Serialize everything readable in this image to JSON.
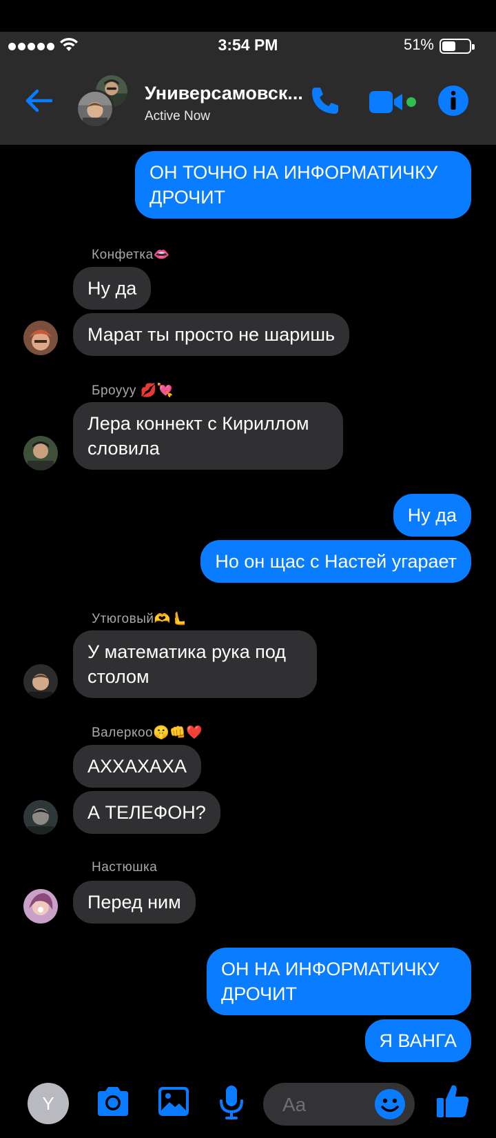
{
  "status_bar": {
    "time": "3:54 PM",
    "battery": "51%",
    "battery_level": 0.51
  },
  "header": {
    "title": "Универсамовск...",
    "subtitle": "Active Now",
    "icons": [
      "back-arrow-icon",
      "phone-icon",
      "video-icon",
      "info-icon"
    ]
  },
  "messages": [
    {
      "from": "me",
      "text": "ОН ТОЧНО НА ИНФОРМАТИЧКУ ДРОЧИТ"
    },
    {
      "from": "Конфетка👄",
      "sender_label": "Конфетка👄",
      "text": "Ну да"
    },
    {
      "from": "Конфетка👄",
      "text": "Марат ты просто не шаришь"
    },
    {
      "from": "Броууу 💋💘",
      "sender_label": "Броууу 💋💘",
      "text": "Лера коннект с Кириллом словила"
    },
    {
      "from": "me",
      "text": "Ну да"
    },
    {
      "from": "me",
      "text": "Но он щас с Настей угарает"
    },
    {
      "from": "Утюговый🫶🫷",
      "sender_label": "Утюговый🫶🫷",
      "text": "У математика рука под столом"
    },
    {
      "from": "Валеркоо🤫👊❤️",
      "sender_label": "Валеркоо🤫👊❤️",
      "text": "АХХАХАХА"
    },
    {
      "from": "Валеркоо🤫👊❤️",
      "text": "А ТЕЛЕФОН?"
    },
    {
      "from": "Настюшка",
      "sender_label": "Настюшка",
      "text": "Перед ним"
    },
    {
      "from": "me",
      "text": "ОН НА ИНФОРМАТИЧКУ ДРОЧИТ"
    },
    {
      "from": "me",
      "text": "Я ВАНГА"
    }
  ],
  "composer": {
    "avatar_letter": "Y",
    "placeholder": "Aa",
    "icons": [
      "camera-icon",
      "image-icon",
      "microphone-icon",
      "emoji-icon",
      "thumbs-up-icon"
    ]
  },
  "colors": {
    "accent": "#0a7cff",
    "incoming_bubble": "#303033",
    "header_bg": "#2b2b2b",
    "online_dot": "#2dbe4e"
  }
}
